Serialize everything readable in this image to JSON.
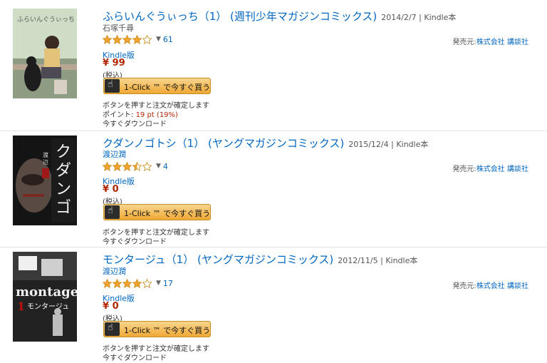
{
  "colors": {
    "link": "#0066c0",
    "price": "#b12704",
    "star": "#f0a32e"
  },
  "items": [
    {
      "title": "ふらいんぐうぃっち（1） (週刊少年マガジンコミックス)",
      "meta": "2014/2/7 | Kindle本",
      "author": "石塚千尋",
      "rating": 4,
      "review_count": "61",
      "publisher_label": "発売元:",
      "publisher": "株式会社 講談社",
      "format": "Kindle版",
      "price": "¥ 99",
      "tax": "(税込)",
      "buy_label": "1-Click ™ で今すぐ買う",
      "note": "ボタンを押すと注文が確定します",
      "points_label": "ポイント:",
      "points_value": "19 pt (19%)",
      "download": "今すぐダウンロード"
    },
    {
      "title": "クダンノゴトシ（1） (ヤングマガジンコミックス)",
      "meta": "2015/12/4 | Kindle本",
      "author": "渡辺潤",
      "rating": 3.5,
      "review_count": "4",
      "publisher_label": "発売元:",
      "publisher": "株式会社 講談社",
      "format": "Kindle版",
      "price": "¥ 0",
      "tax": "(税込)",
      "buy_label": "1-Click ™ で今すぐ買う",
      "note": "ボタンを押すと注文が確定します",
      "download": "今すぐダウンロード"
    },
    {
      "title": "モンタージュ（1） (ヤングマガジンコミックス)",
      "meta": "2012/11/5 | Kindle本",
      "author": "渡辺潤",
      "rating": 4,
      "review_count": "17",
      "publisher_label": "発売元:",
      "publisher": "株式会社 講談社",
      "format": "Kindle版",
      "price": "¥ 0",
      "tax": "(税込)",
      "buy_label": "1-Click ™ で今すぐ買う",
      "note": "ボタンを押すと注文が確定します",
      "download": "今すぐダウンロード"
    }
  ]
}
